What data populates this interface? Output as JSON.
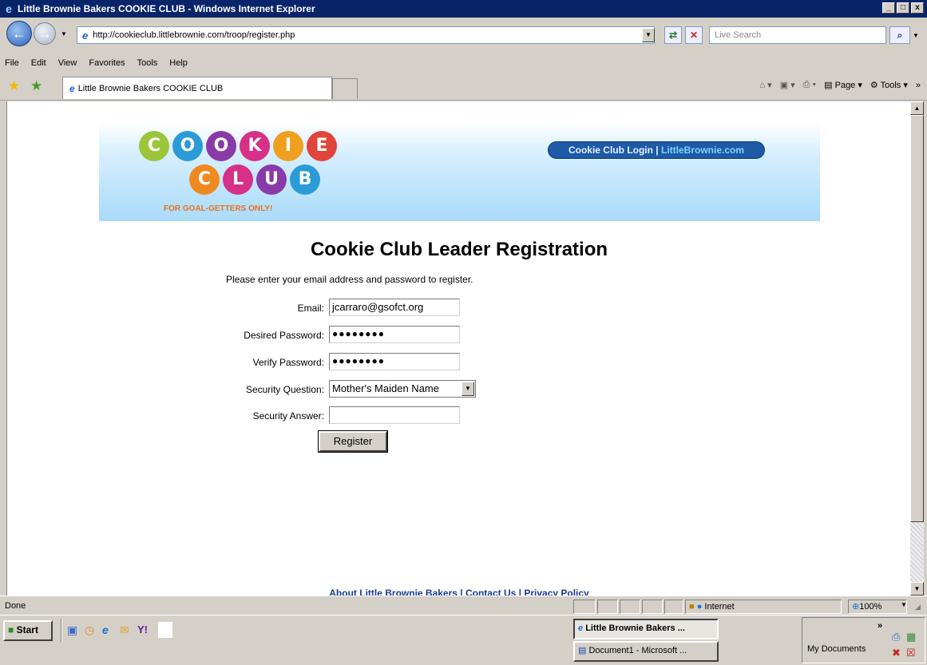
{
  "window": {
    "title": "Little Brownie Bakers COOKIE CLUB - Windows Internet Explorer",
    "controls": [
      "_",
      "□",
      "x"
    ]
  },
  "address": {
    "url": "http://cookieclub.littlebrownie.com/troop/register.php",
    "search_placeholder": "Live Search"
  },
  "menu": [
    "File",
    "Edit",
    "View",
    "Favorites",
    "Tools",
    "Help"
  ],
  "tab": {
    "label": "Little Brownie Bakers COOKIE CLUB"
  },
  "toolbar": {
    "page_label": "Page",
    "tools_label": "Tools",
    "more": "»"
  },
  "banner": {
    "logo_row1": [
      "C",
      "O",
      "O",
      "K",
      "I",
      "E"
    ],
    "logo_row2": [
      "C",
      "L",
      "U",
      "B"
    ],
    "tagline": "FOR GOAL-GETTERS ONLY!",
    "login_link": "Cookie Club Login",
    "sep": " | ",
    "site_link": "LittleBrownie.com"
  },
  "form": {
    "title": "Cookie Club Leader Registration",
    "intro": "Please enter your email address and password to register.",
    "email_label": "Email:",
    "email_value": "jcarraro@gsofct.org",
    "password_label": "Desired Password:",
    "password_mask": "●●●●●●●●",
    "verify_label": "Verify Password:",
    "verify_mask": "●●●●●●●●",
    "question_label": "Security Question:",
    "question_value": "Mother's Maiden Name",
    "answer_label": "Security Answer:",
    "answer_value": "",
    "register_label": "Register"
  },
  "footer": {
    "about": "About Little Brownie Bakers",
    "contact": "Contact Us",
    "privacy": "Privacy Policy",
    "sep": " | "
  },
  "status": {
    "text": "Done",
    "zone": "Internet",
    "zoom": "100%"
  },
  "taskbar": {
    "start": "Start",
    "tasks": [
      "Little Brownie Bakers ...",
      "Document1 - Microsoft ..."
    ],
    "tray_label": "My Documents",
    "tray_more": "»"
  }
}
